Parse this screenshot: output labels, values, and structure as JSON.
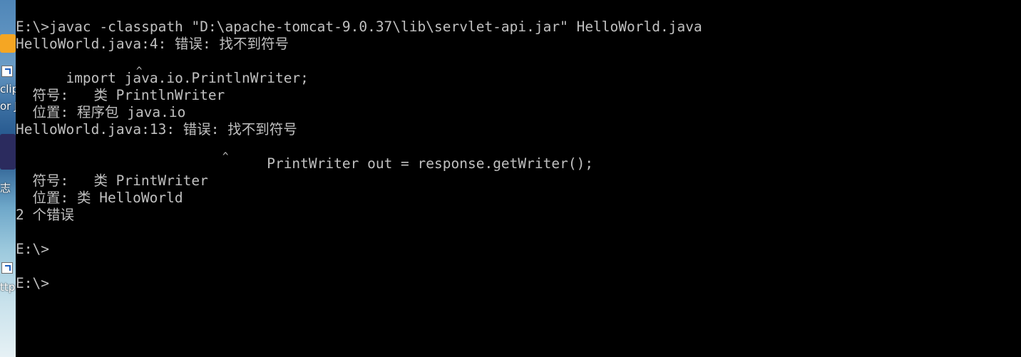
{
  "desktop": {
    "icon_labels": [
      "clip",
      "or J",
      "志",
      "ttp"
    ]
  },
  "console": {
    "lines": [
      "E:\\>javac -classpath \"D:\\apache-tomcat-9.0.37\\lib\\servlet-api.jar\" HelloWorld.java",
      "HelloWorld.java:4: 错误: 找不到符号",
      "import java.io.PrintlnWriter;",
      "",
      "  符号:   类 PrintlnWriter",
      "  位置: 程序包 java.io",
      "HelloWorld.java:13: 错误: 找不到符号",
      "                        PrintWriter out = response.getWriter();",
      "",
      "  符号:   类 PrintWriter",
      "  位置: 类 HelloWorld",
      "2 个错误",
      "",
      "E:\\>",
      "",
      "E:\\>"
    ],
    "caret_glyph": "^"
  },
  "colors": {
    "background": "#000000",
    "text": "#c0c0c0"
  }
}
